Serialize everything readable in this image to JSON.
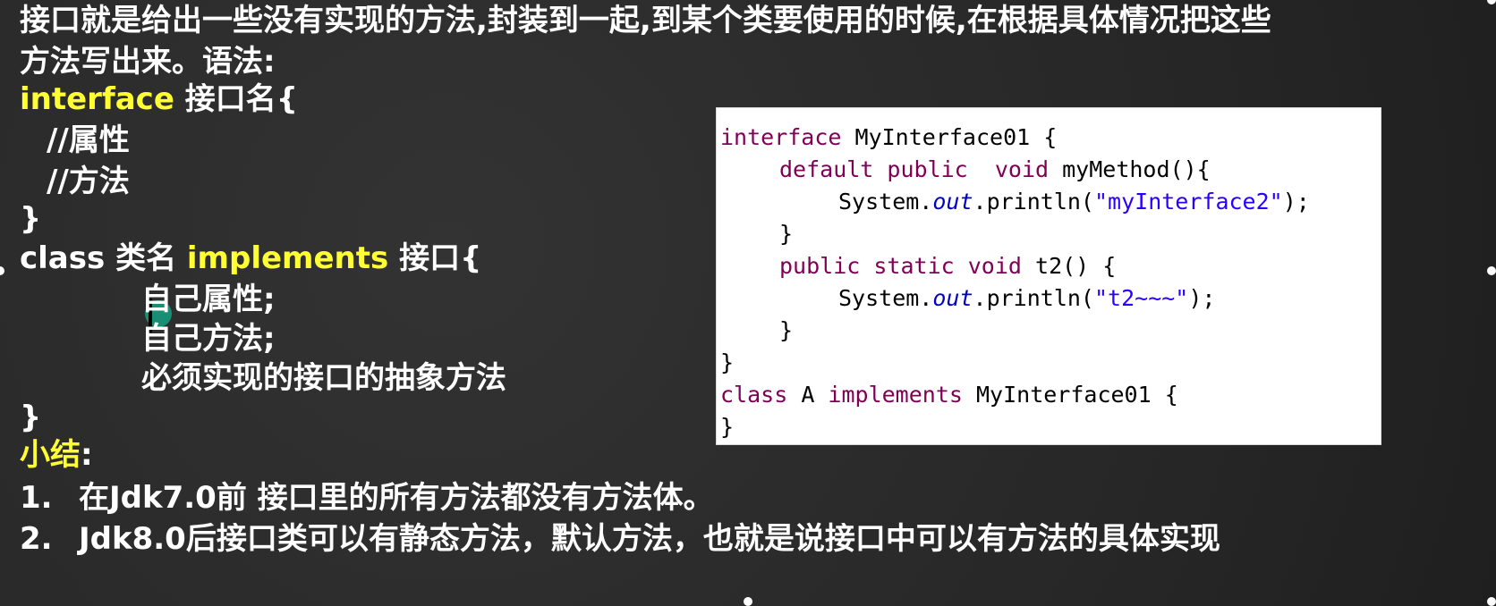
{
  "slide": {
    "intro_line1": "接口就是给出一些没有实现的方法,封装到一起,到某个类要使用的时候,在根据具体情况把这些",
    "intro_line2": "方法写出来。语法:",
    "syntax": {
      "interface_kw": "interface",
      "interface_rest": " 接口名{",
      "comment_attr": "//属性",
      "comment_method": "//方法",
      "close_brace": "}",
      "class_prefix": "class 类名 ",
      "implements_kw": "implements",
      "class_rest": " 接口{",
      "own_attr": "自己属性;",
      "own_method": "自己方法;",
      "must_impl": "必须实现的接口的抽象方法",
      "close_brace2": "}"
    },
    "summary": {
      "title": "小结",
      "colon": ":",
      "items": [
        {
          "num": "1.",
          "text": "在Jdk7.0前 接口里的所有方法都没有方法体。"
        },
        {
          "num": "2.",
          "text": "Jdk8.0后接口类可以有静态方法，默认方法，也就是说接口中可以有方法的具体实现"
        }
      ]
    }
  },
  "code": {
    "l1_kw": "interface",
    "l1_rest": " MyInterface01 {",
    "l2_kw1": "default",
    "l2_kw2": "public",
    "l2_kw3": "void",
    "l2_rest": " myMethod(){",
    "l3_pre": "System.",
    "l3_field": "out",
    "l3_mid": ".println(",
    "l3_str": "\"myInterface2\"",
    "l3_end": ");",
    "l4": "}",
    "l5_kw1": "public",
    "l5_kw2": "static",
    "l5_kw3": "void",
    "l5_rest": " t2() {",
    "l6_pre": "System.",
    "l6_field": "out",
    "l6_mid": ".println(",
    "l6_str": "\"t2~~~\"",
    "l6_end": ");",
    "l7": "}",
    "l8": "}",
    "l9_kw1": "class",
    "l9_mid": " A ",
    "l9_kw2": "implements",
    "l9_rest": " MyInterface01 {",
    "l10": "}"
  }
}
